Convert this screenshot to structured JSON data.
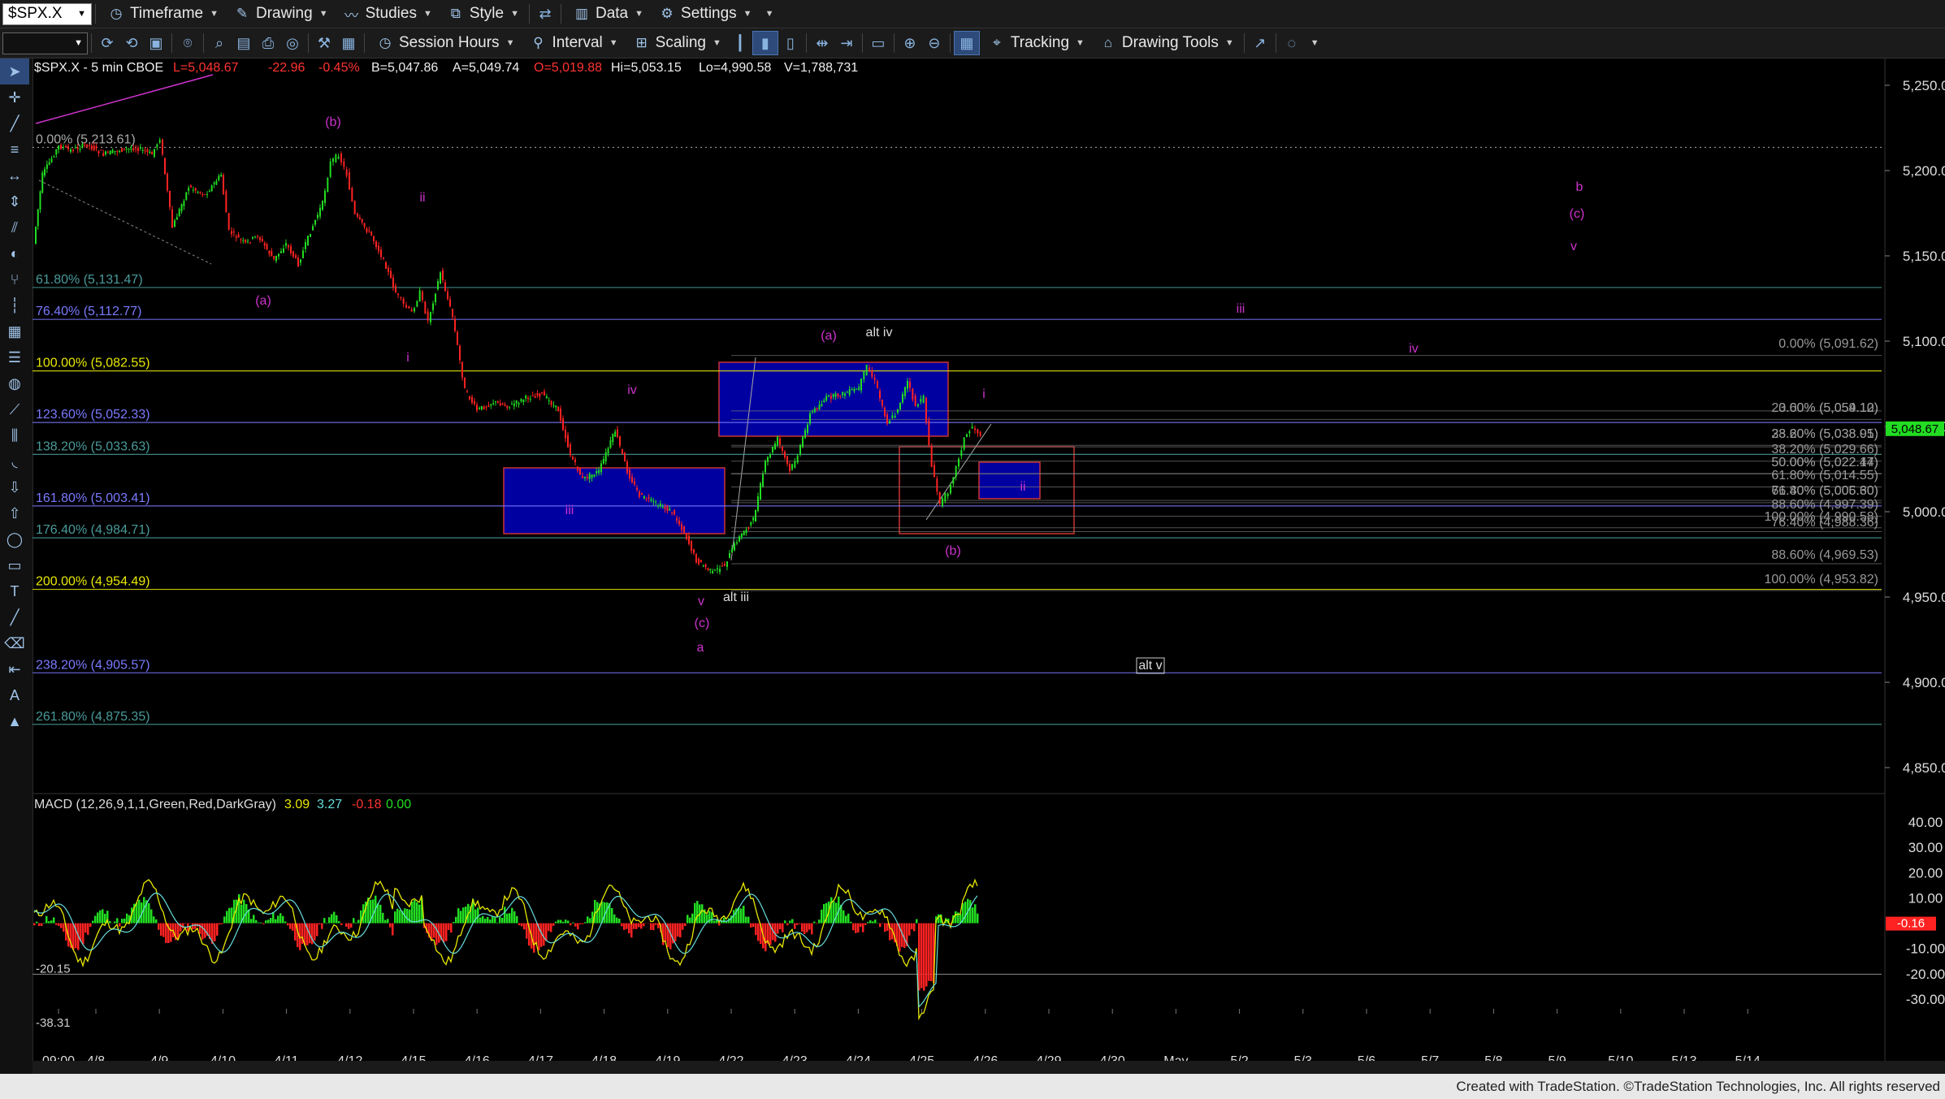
{
  "toolbar": {
    "symbol": "$SPX.X",
    "timeframe": "Timeframe",
    "drawing": "Drawing",
    "studies": "Studies",
    "style": "Style",
    "data": "Data",
    "settings": "Settings",
    "session_hours": "Session Hours",
    "interval": "Interval",
    "scaling": "Scaling",
    "tracking": "Tracking",
    "drawing_tools": "Drawing Tools"
  },
  "header": {
    "title": "$SPX.X - 5 min  CBOE",
    "last": "L=5,048.67",
    "change": "-22.96",
    "change_pct": "-0.45%",
    "bid": "B=5,047.86",
    "ask": "A=5,049.74",
    "open": "O=5,019.88",
    "high": "Hi=5,053.15",
    "low": "Lo=4,990.58",
    "volume": "V=1,788,731"
  },
  "colors": {
    "up": "#22dd22",
    "down": "#ff2222",
    "wave": "#cc33cc",
    "fib": "#8a8aff",
    "box": "#0000a0"
  },
  "price_axis": {
    "min": 4830,
    "max": 5260,
    "ticks": [
      "5,250.00",
      "5,200.00",
      "5,150.00",
      "5,100.00",
      "5,050.00",
      "5,000.00",
      "4,950.00",
      "4,900.00",
      "4,850.00"
    ],
    "tick_values": [
      5250,
      5200,
      5150,
      5100,
      5050,
      5000,
      4950,
      4900,
      4850
    ],
    "last_price": "5,048.67",
    "last_value": 5048.67
  },
  "time_axis": {
    "labels": [
      "09:00",
      "4/8",
      "4/9",
      "4/10",
      "4/11",
      "4/12",
      "4/15",
      "4/16",
      "4/17",
      "4/18",
      "4/19",
      "4/22",
      "4/23",
      "4/24",
      "4/25",
      "4/26",
      "4/29",
      "4/30",
      "May",
      "5/2",
      "5/3",
      "5/6",
      "5/7",
      "5/8",
      "5/9",
      "5/10",
      "5/13",
      "5/14"
    ]
  },
  "fib_left": [
    {
      "label": "0.00% (5,213.61)",
      "value": 5213.61,
      "color": "#aaaaaa"
    },
    {
      "label": "61.80% (5,131.47)",
      "value": 5131.47,
      "color": "#4a9a9a"
    },
    {
      "label": "76.40% (5,112.77)",
      "value": 5112.77,
      "color": "#7a7aff"
    },
    {
      "label": "100.00% (5,082.55)",
      "value": 5082.55,
      "color": "#e8e800"
    },
    {
      "label": "123.60% (5,052.33)",
      "value": 5052.33,
      "color": "#7a7aff"
    },
    {
      "label": "138.20% (5,033.63)",
      "value": 5033.63,
      "color": "#4a9a9a"
    },
    {
      "label": "161.80% (5,003.41)",
      "value": 5003.41,
      "color": "#7a7aff"
    },
    {
      "label": "176.40% (4,984.71)",
      "value": 4984.71,
      "color": "#4a9a9a"
    },
    {
      "label": "200.00% (4,954.49)",
      "value": 4954.49,
      "color": "#e8e800"
    },
    {
      "label": "238.20% (4,905.57)",
      "value": 4905.57,
      "color": "#7a7aff"
    },
    {
      "label": "261.80% (4,875.35)",
      "value": 4875.35,
      "color": "#4a9a9a"
    }
  ],
  "fib_right": [
    {
      "label": "0.00% (5,091.62)",
      "value": 5091.62
    },
    {
      "label": "23.60% (5,059.10)",
      "value": 5059.1
    },
    {
      "label": "0.00% (5,054.12)",
      "value": 5054.12
    },
    {
      "label": "38.20% (5,038.91)",
      "value": 5038.91
    },
    {
      "label": "23.60% (5,038.05)",
      "value": 5038.05
    },
    {
      "label": "38.20% (5,029.66)",
      "value": 5029.66
    },
    {
      "label": "50.00% (5,022.17)",
      "value": 5022.17
    },
    {
      "label": "50.00% (5,022.44)",
      "value": 5022.44
    },
    {
      "label": "61.80% (5,014.55)",
      "value": 5014.55
    },
    {
      "label": "76.40% (5,006.60)",
      "value": 5006.6
    },
    {
      "label": "61.80% (5,005.30)",
      "value": 5005.3
    },
    {
      "label": "88.60% (4,997.39)",
      "value": 4997.39
    },
    {
      "label": "100.00% (4,990.58)",
      "value": 4990.58
    },
    {
      "label": "76.40% (4,988.36)",
      "value": 4988.36
    },
    {
      "label": "88.60% (4,969.53)",
      "value": 4969.53
    },
    {
      "label": "100.00% (4,953.82)",
      "value": 4953.82
    }
  ],
  "wave_labels": [
    {
      "text": "(b)",
      "color": "#cc33cc"
    },
    {
      "text": "(a)",
      "color": "#cc33cc"
    },
    {
      "text": "ii",
      "color": "#cc33cc"
    },
    {
      "text": "i",
      "color": "#cc33cc"
    },
    {
      "text": "iv",
      "color": "#cc33cc"
    },
    {
      "text": "iii",
      "color": "#cc33cc"
    },
    {
      "text": "v",
      "color": "#cc33cc"
    },
    {
      "text": "(c)",
      "color": "#cc33cc"
    },
    {
      "text": "a",
      "color": "#cc33cc"
    },
    {
      "text": "alt iii",
      "color": "#dddddd"
    },
    {
      "text": "(a)",
      "color": "#cc33cc"
    },
    {
      "text": "alt iv",
      "color": "#dddddd"
    },
    {
      "text": "i",
      "color": "#cc33cc"
    },
    {
      "text": "ii",
      "color": "#cc33cc"
    },
    {
      "text": "(b)",
      "color": "#cc33cc"
    },
    {
      "text": "iii",
      "color": "#cc33cc"
    },
    {
      "text": "iv",
      "color": "#cc33cc"
    },
    {
      "text": "b",
      "color": "#cc33cc"
    },
    {
      "text": "(c)",
      "color": "#cc33cc"
    },
    {
      "text": "v",
      "color": "#cc33cc"
    },
    {
      "text": "alt v",
      "color": "#dddddd"
    }
  ],
  "macd": {
    "title": "MACD (12,26,9,1,1,Green,Red,DarkGray)",
    "v1": "3.09",
    "v2": "3.27",
    "v3": "-0.18",
    "v4": "0.00",
    "low_label": "-20.15",
    "min_label": "-38.31",
    "last_value": "-0.16",
    "axis": [
      "40.00",
      "30.00",
      "20.00",
      "10.00",
      "-10.00",
      "-20.00",
      "-30.00"
    ],
    "axis_values": [
      40,
      30,
      20,
      10,
      -10,
      -20,
      -30
    ],
    "min": -40,
    "max": 47
  },
  "footer": "Created with TradeStation. ©TradeStation Technologies, Inc. All rights reserved"
}
